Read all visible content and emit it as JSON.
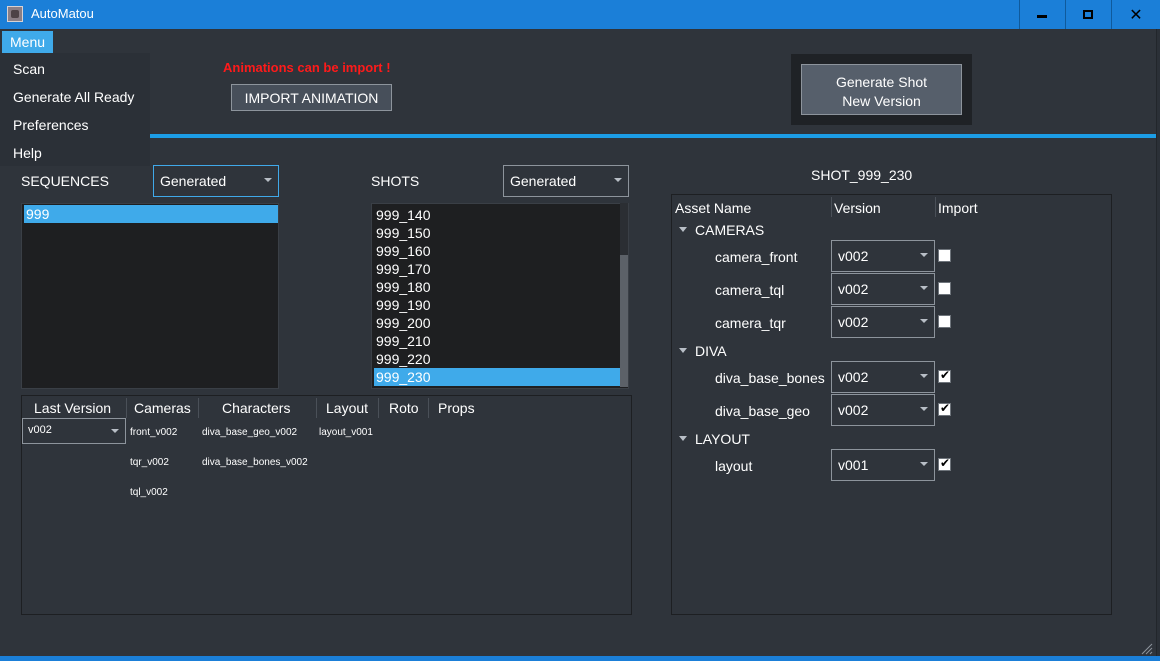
{
  "window": {
    "title": "AutoMatou"
  },
  "colors": {
    "accent": "#3faaea",
    "titlebar": "#1b7fd8",
    "background": "#2f343b",
    "warning": "#ff1a1a"
  },
  "menu": {
    "label": "Menu",
    "items": [
      "Scan",
      "Generate All Ready",
      "Preferences",
      "Help"
    ]
  },
  "warning": "Animations can be import !",
  "import_button": "IMPORT ANIMATION",
  "generate_button": {
    "line1": "Generate Shot",
    "line2": "New Version"
  },
  "sequences": {
    "label": "SEQUENCES",
    "filter": "Generated",
    "items": [
      "999"
    ],
    "selected": "999"
  },
  "shots": {
    "label": "SHOTS",
    "filter": "Generated",
    "items": [
      "999_140",
      "999_150",
      "999_160",
      "999_170",
      "999_180",
      "999_190",
      "999_200",
      "999_210",
      "999_220",
      "999_230"
    ],
    "selected": "999_230"
  },
  "details": {
    "headers": [
      "Last Version",
      "Cameras",
      "Characters",
      "Layout",
      "Roto",
      "Props"
    ],
    "version": "v002",
    "cameras": [
      "front_v002",
      "tqr_v002",
      "tql_v002"
    ],
    "characters": [
      "diva_base_geo_v002",
      "diva_base_bones_v002"
    ],
    "layout": [
      "layout_v001"
    ]
  },
  "shot_panel": {
    "title": "SHOT_999_230",
    "headers": [
      "Asset Name",
      "Version",
      "Import"
    ],
    "groups": [
      {
        "name": "CAMERAS",
        "assets": [
          {
            "name": "camera_front",
            "version": "v002",
            "checked": false
          },
          {
            "name": "camera_tql",
            "version": "v002",
            "checked": false
          },
          {
            "name": "camera_tqr",
            "version": "v002",
            "checked": false
          }
        ]
      },
      {
        "name": "DIVA",
        "assets": [
          {
            "name": "diva_base_bones",
            "version": "v002",
            "checked": true
          },
          {
            "name": "diva_base_geo",
            "version": "v002",
            "checked": true
          }
        ]
      },
      {
        "name": "LAYOUT",
        "assets": [
          {
            "name": "layout",
            "version": "v001",
            "checked": true
          }
        ]
      }
    ]
  },
  "icons": {
    "app": "app-icon",
    "minimize": "minimize-icon",
    "maximize": "maximize-icon",
    "close": "close-icon",
    "dropdown": "chevron-down-icon",
    "tree_expand": "tree-expand-icon",
    "checkmark": "checkmark-icon",
    "resize": "resize-grip-icon"
  }
}
